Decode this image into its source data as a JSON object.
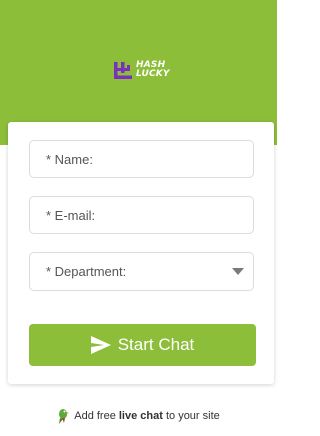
{
  "brand": {
    "logo_text_line1": "HASH",
    "logo_text_line2": "LUCKY",
    "header_color": "#8cbe3a",
    "logo_mark_color": "#7b2fbf"
  },
  "form": {
    "name_placeholder": "* Name:",
    "email_placeholder": "* E-mail:",
    "department_placeholder": "* Department:",
    "start_button_label": "Start Chat",
    "button_color": "#8cbe3a"
  },
  "footer": {
    "prefix": "Add free ",
    "bold_text": "live chat",
    "suffix": " to your site",
    "icon": "parrot-icon"
  },
  "icons": {
    "send": "paper-plane-icon",
    "dropdown": "chevron-down-icon"
  }
}
